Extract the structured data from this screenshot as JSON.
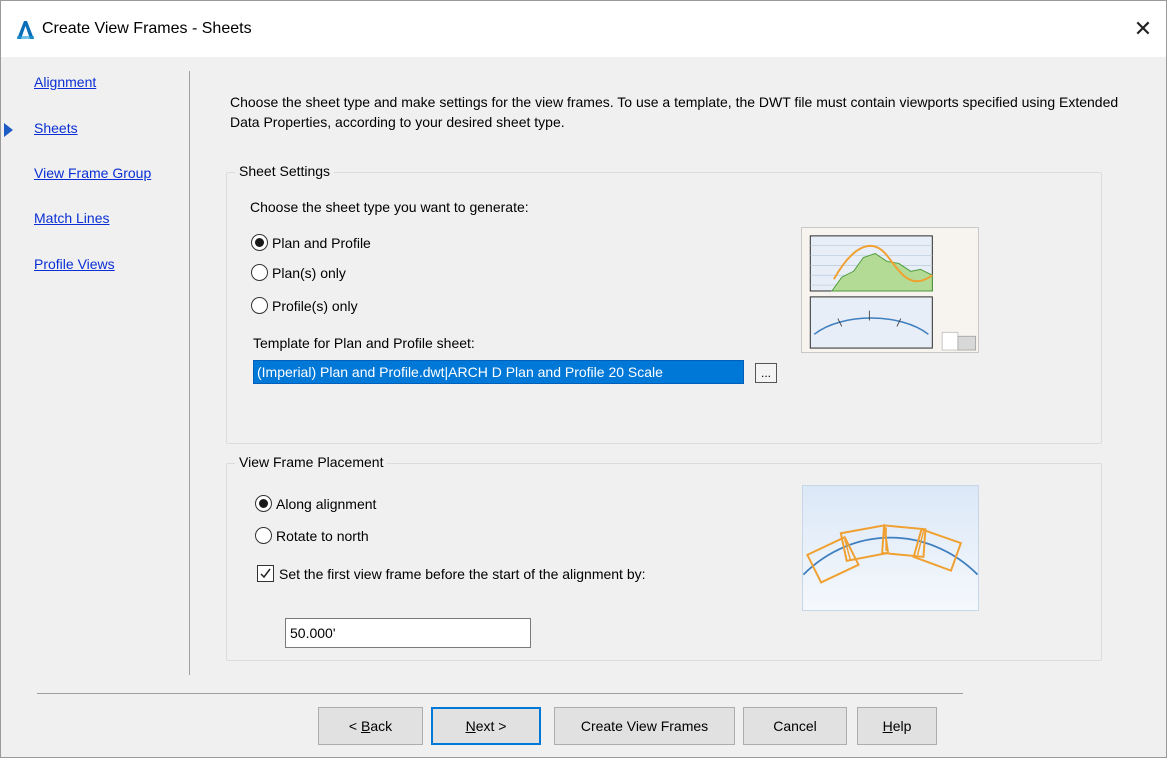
{
  "window": {
    "title": "Create View Frames - Sheets",
    "close_glyph": "✕",
    "app_icon": "autocad-civil3d-icon"
  },
  "nav": {
    "items": [
      {
        "label": "Alignment",
        "active": false
      },
      {
        "label": "Sheets",
        "active": true
      },
      {
        "label": "View Frame Group",
        "active": false
      },
      {
        "label": "Match Lines",
        "active": false
      },
      {
        "label": "Profile Views",
        "active": false
      }
    ]
  },
  "intro_text": "Choose the sheet type and make settings for the view frames. To use a template, the DWT file must contain viewports specified using Extended Data Properties, according to your desired sheet type.",
  "sheet_settings": {
    "group_label": "Sheet Settings",
    "prompt": "Choose the sheet type you want to generate:",
    "options": [
      {
        "label": "Plan and Profile",
        "checked": true
      },
      {
        "label": "Plan(s) only",
        "checked": false
      },
      {
        "label": "Profile(s) only",
        "checked": false
      }
    ],
    "template_label": "Template for Plan and Profile sheet:",
    "template_value": "(Imperial) Plan and Profile.dwt|ARCH D Plan and Profile 20 Scale",
    "browse_label": "..."
  },
  "view_frame_placement": {
    "group_label": "View Frame Placement",
    "options": [
      {
        "label": "Along alignment",
        "checked": true
      },
      {
        "label": "Rotate to north",
        "checked": false
      }
    ],
    "offset_checkbox": {
      "label": "Set the first view frame before the start of the alignment by:",
      "checked": true
    },
    "offset_value": "50.000'"
  },
  "buttons": {
    "back_prefix": "< ",
    "back_mnemonic": "B",
    "back_rest": "ack",
    "next_mnemonic": "N",
    "next_rest": "ext >",
    "create": "Create View Frames",
    "cancel": "Cancel",
    "help_mnemonic": "H",
    "help_rest": "elp"
  },
  "colors": {
    "link": "#0b2fd4",
    "selection": "#0078d7",
    "accent_orange": "#f0a030",
    "alignment_blue": "#3f7fc0"
  }
}
